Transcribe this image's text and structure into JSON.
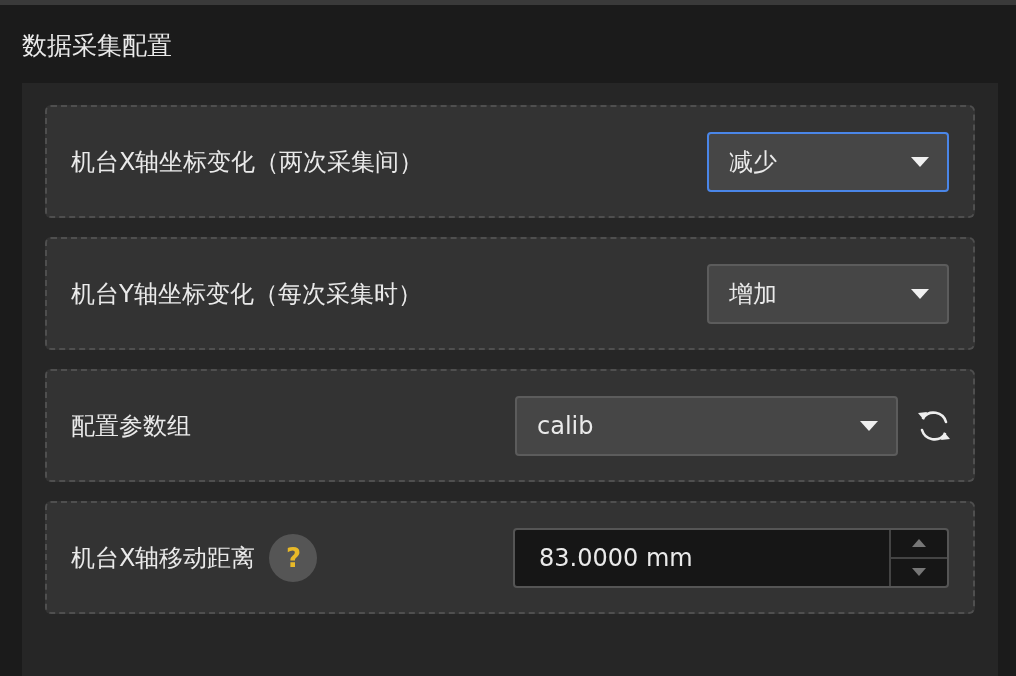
{
  "panel": {
    "title": "数据采集配置"
  },
  "rows": [
    {
      "kind": "select",
      "label": "机台X轴坐标变化（两次采集间）",
      "value": "减少",
      "focused": true
    },
    {
      "kind": "select",
      "label": "机台Y轴坐标变化（每次采集时）",
      "value": "增加",
      "focused": false
    },
    {
      "kind": "combo",
      "label": "配置参数组",
      "value": "calib"
    },
    {
      "kind": "number",
      "label": "机台X轴移动距离",
      "help": "?",
      "value": "83.0000 mm"
    }
  ]
}
